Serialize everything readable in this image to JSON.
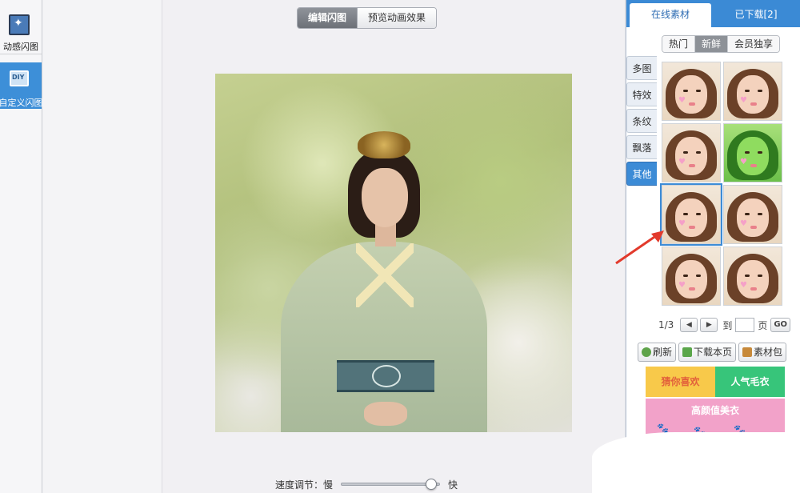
{
  "left_tools": [
    {
      "label": "动感闪图",
      "icon": "sparkle-frame-icon"
    },
    {
      "label": "自定义闪图",
      "icon": "diy-icon",
      "icon_text": "DIY",
      "active": true
    }
  ],
  "canvas": {
    "modes": [
      {
        "label": "编辑闪图",
        "active": true
      },
      {
        "label": "预览动画效果",
        "active": false
      }
    ],
    "speed": {
      "label": "速度调节：",
      "slow": "慢",
      "fast": "快",
      "value": 0.9
    }
  },
  "right_panel": {
    "tabs": [
      {
        "label": "在线素材",
        "active": true
      },
      {
        "label": "已下载[2]",
        "active": false
      }
    ],
    "subtabs": [
      {
        "label": "热门",
        "active": false
      },
      {
        "label": "新鲜",
        "active": true
      },
      {
        "label": "会员独享",
        "active": false
      }
    ],
    "categories": [
      {
        "label": "多图",
        "active": false
      },
      {
        "label": "特效",
        "active": false
      },
      {
        "label": "条纹",
        "active": false
      },
      {
        "label": "飘落",
        "active": false
      },
      {
        "label": "其他",
        "active": true
      }
    ],
    "thumbnails": [
      {
        "tint": "normal"
      },
      {
        "tint": "normal"
      },
      {
        "tint": "normal"
      },
      {
        "tint": "green"
      },
      {
        "tint": "normal",
        "selected": true
      },
      {
        "tint": "normal"
      },
      {
        "tint": "normal"
      },
      {
        "tint": "normal"
      }
    ],
    "pager": {
      "current": "1/3",
      "prev": "◀",
      "next": "▶",
      "goto_label": "到",
      "page_suffix": "页",
      "go": "GO"
    },
    "actions": {
      "refresh": "刷新",
      "download_page": "下载本页",
      "material_pack": "素材包"
    },
    "banners": {
      "left": "猜你喜欢",
      "right": "人气毛衣",
      "bottom": "高颜值美衣"
    }
  },
  "colors": {
    "accent": "#3c8bd6",
    "annotation_arrow": "#e23a2c"
  }
}
